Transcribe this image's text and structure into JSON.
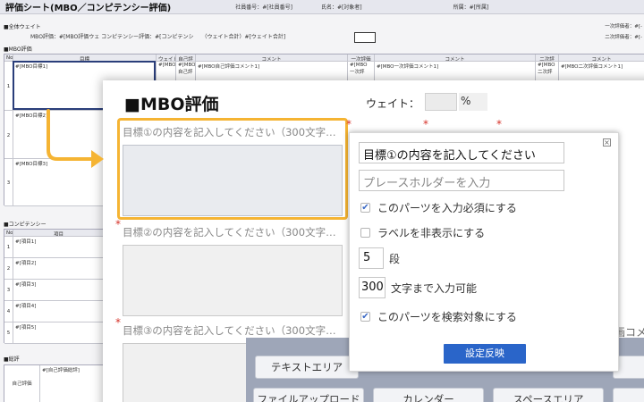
{
  "sheet": {
    "title": "評価シート(MBO／コンピテンシー評価)",
    "employee_no": "社員番号：#[社員番号]",
    "name": "氏名：#[対象者]",
    "dept": "所属：#[所属]",
    "total_weight": "■全体ウェイト",
    "weight_line": "MBO評価：#[MBO評価ウェ コンピテンシー評価：#[コンピテンシ　　（ウェイト合計）#[ウェイト合計]",
    "approver1": "一次評価者：#[-",
    "approver2": "二次評価者：#[-",
    "mbo_section": "■MBO評価",
    "mbo_headers": [
      "No.",
      "目標",
      "ウェイト",
      "自己評",
      "コメント",
      "一次評価",
      "コメント",
      "二次評",
      "コメント"
    ],
    "mbo_rows": [
      {
        "no": "1",
        "goal": "#[MBO目標1]",
        "w": "#[MBO",
        "self": "#[MBO",
        "self_sub": "自己評",
        "comment": "#[MBO自己評価コメント1]",
        "first": "#[MBO",
        "first_sub": "一次評",
        "first_comment": "#[MBO一次評価コメント1]",
        "second": "#[MBO",
        "second_sub": "二次評",
        "second_comment": "#[MBO二次評価コメント1]"
      },
      {
        "no": "2",
        "goal": "#[MBO目標2]"
      },
      {
        "no": "3",
        "goal": "#[MBO目標3]"
      }
    ],
    "competency_section": "■コンピテンシー",
    "comp_headers": [
      "No.",
      "項目"
    ],
    "comp_rows": [
      {
        "no": "1",
        "item": "#[項目1]"
      },
      {
        "no": "2",
        "item": "#[項目2]"
      },
      {
        "no": "3",
        "item": "#[項目3]"
      },
      {
        "no": "4",
        "item": "#[項目4]"
      },
      {
        "no": "5",
        "item": "#[項目5]"
      }
    ],
    "summary_section": "■総評",
    "summary_label": "自己評価",
    "summary_value": "#[自己評価総評]"
  },
  "editor": {
    "title": "■MBO評価",
    "weight_label": "ウェイト：",
    "weight_unit": "%",
    "objective1_label": "目標①の内容を記入してください（300文字…",
    "objective2_label": "目標②の内容を記入してください（300文字…",
    "objective3_label": "目標③の内容を記入してください（300文字…",
    "partial_text_right": "画コメ"
  },
  "palette": {
    "buttons": [
      "テキストエリア",
      "ファイルアップロード",
      "カレンダー",
      "スペースエリア"
    ]
  },
  "props": {
    "label_value": "目標①の内容を記入してください",
    "placeholder_value": "プレースホルダーを入力",
    "required_label": "このパーツを入力必須にする",
    "required_checked": true,
    "hide_label": "ラベルを非表示にする",
    "hide_checked": false,
    "rows_value": "5",
    "rows_unit": "段",
    "maxlen_value": "300",
    "maxlen_unit": "文字まで入力可能",
    "search_label": "このパーツを検索対象にする",
    "search_checked": true,
    "apply_label": "設定反映"
  },
  "colors": {
    "highlight": "#f5b433",
    "accent_blue": "#2a65c9",
    "required_red": "#d6332a"
  }
}
